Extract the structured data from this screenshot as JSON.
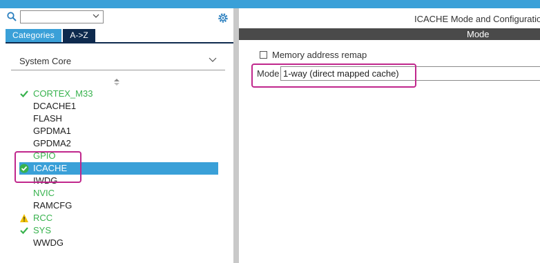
{
  "sidebar": {
    "search": {
      "value": ""
    },
    "tabs": [
      {
        "label": "Categories"
      },
      {
        "label": "A->Z"
      }
    ],
    "category": {
      "selected": "System Core"
    },
    "items": [
      {
        "label": "CORTEX_M33",
        "status": "ok",
        "color": "#37b24d"
      },
      {
        "label": "DCACHE1",
        "status": "none"
      },
      {
        "label": "FLASH",
        "status": "none"
      },
      {
        "label": "GPDMA1",
        "status": "none"
      },
      {
        "label": "GPDMA2",
        "status": "none"
      },
      {
        "label": "GPIO",
        "status": "none",
        "color": "#37b24d"
      },
      {
        "label": "ICACHE",
        "status": "ok-selected",
        "selected": true
      },
      {
        "label": "IWDG",
        "status": "none"
      },
      {
        "label": "NVIC",
        "status": "none",
        "color": "#37b24d"
      },
      {
        "label": "RAMCFG",
        "status": "none"
      },
      {
        "label": "RCC",
        "status": "warning",
        "color": "#37b24d"
      },
      {
        "label": "SYS",
        "status": "ok",
        "color": "#37b24d"
      },
      {
        "label": "WWDG",
        "status": "none"
      }
    ]
  },
  "main": {
    "title": "ICACHE Mode and Configuratio",
    "section_header": "Mode",
    "memory_remap": {
      "label": "Memory address remap",
      "checked": false
    },
    "mode": {
      "label": "Mode",
      "value": "1-way (direct mapped cache)"
    }
  },
  "colors": {
    "accent": "#3aa0d8",
    "tab_dark": "#0e2a4e",
    "ok_green": "#37b24d",
    "highlight": "#c0268c",
    "warning": "#f2c200"
  }
}
